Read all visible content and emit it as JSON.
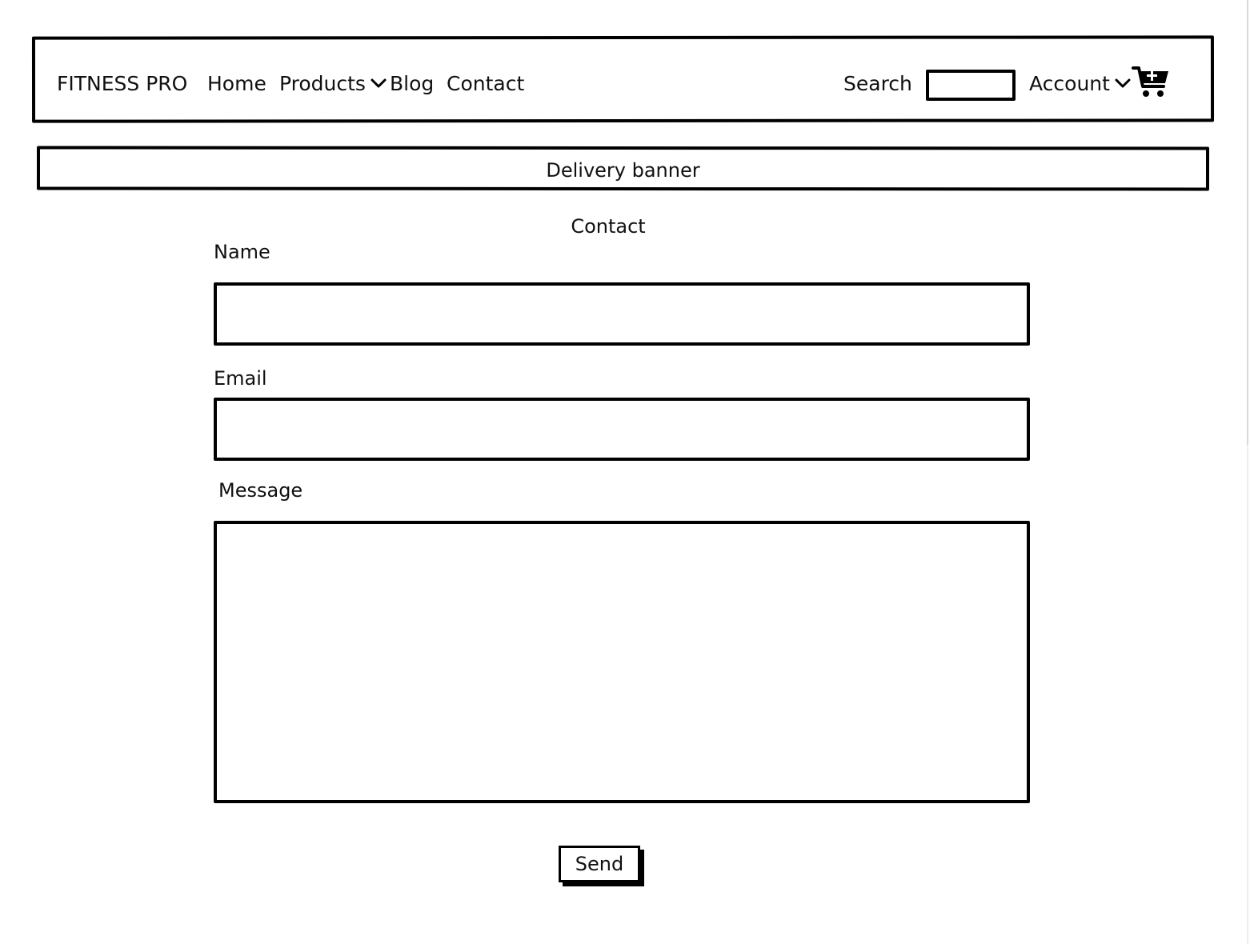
{
  "header": {
    "brand": "FITNESS PRO",
    "nav": {
      "home": "Home",
      "products": "Products",
      "blog": "Blog",
      "contact": "Contact"
    },
    "search_label": "Search",
    "search_value": "",
    "account_label": "Account",
    "cart_icon": "shopping-cart-plus-icon",
    "dropdown_icon": "chevron-down-icon"
  },
  "banner": {
    "text": "Delivery banner"
  },
  "form": {
    "title": "Contact",
    "name_label": "Name",
    "name_value": "",
    "email_label": "Email",
    "email_value": "",
    "message_label": "Message",
    "message_value": "",
    "send_label": "Send"
  },
  "colors": {
    "stroke": "#000000",
    "background": "#ffffff",
    "text": "#111111"
  }
}
